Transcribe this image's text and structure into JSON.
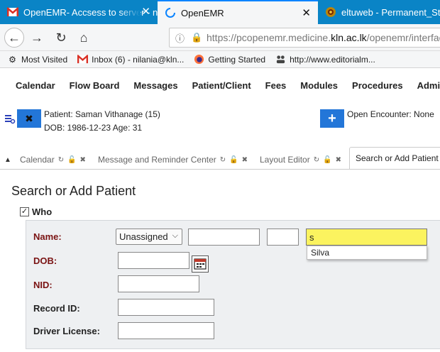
{
  "browser": {
    "tabs": [
      {
        "title": "OpenEMR- Accsess to server - n",
        "icon": "gmail-icon"
      },
      {
        "title": "OpenEMR",
        "icon": "openemr-icon"
      },
      {
        "title": "eltuweb - Permanent_Staff",
        "icon": "university-icon"
      }
    ],
    "url_prefix": "https://pcopenemr.medicine.",
    "url_domain": "kln.ac.lk",
    "url_suffix": "/openemr/interfac",
    "bookmarks": [
      {
        "label": "Most Visited",
        "icon": "gear-icon"
      },
      {
        "label": "Inbox (6) - nilania@kln...",
        "icon": "gmail-icon"
      },
      {
        "label": "Getting Started",
        "icon": "firefox-icon"
      },
      {
        "label": "http://www.editorialm...",
        "icon": "people-icon"
      }
    ]
  },
  "menu": {
    "items": [
      "Calendar",
      "Flow Board",
      "Messages",
      "Patient/Client",
      "Fees",
      "Modules",
      "Procedures",
      "Administ"
    ]
  },
  "patient": {
    "name_line": "Patient: Saman Vithanage (15)",
    "dob_line": "DOB: 1986-12-23 Age: 31",
    "encounter": "Open Encounter: None"
  },
  "emr_tabs": [
    {
      "label": "Calendar"
    },
    {
      "label": "Message and Reminder Center"
    },
    {
      "label": "Layout Editor"
    },
    {
      "label": "Search or Add Patient"
    }
  ],
  "page": {
    "title": "Search or Add Patient",
    "section": "Who"
  },
  "form": {
    "name_label": "Name:",
    "name_title_value": "Unassigned",
    "first_name": "",
    "middle_name": "",
    "last_name_value": "s",
    "suggestion": "Silva",
    "dob_label": "DOB:",
    "nid_label": "NID:",
    "record_id_label": "Record ID:",
    "driver_license_label": "Driver License:"
  }
}
